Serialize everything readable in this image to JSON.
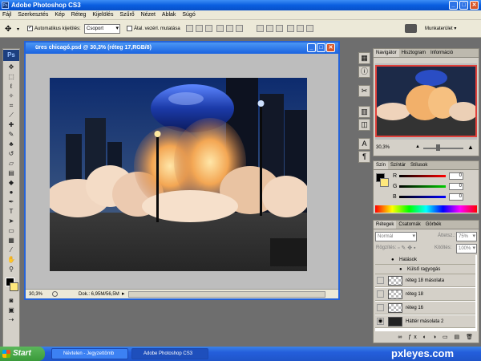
{
  "app": {
    "title": "Adobe Photoshop CS3",
    "ps_badge": "Ps"
  },
  "menu": [
    "Fájl",
    "Szerkesztés",
    "Kép",
    "Réteg",
    "Kijelölés",
    "Szűrő",
    "Nézet",
    "Ablak",
    "Súgó"
  ],
  "options": {
    "auto_select_label": "Automatikus kijelölés:",
    "auto_select_checked": true,
    "group_value": "Csoport",
    "transform_label": "Átal. vezérl. mutatása",
    "transform_checked": false,
    "workspace_label": "Munkaterület"
  },
  "document": {
    "title": "üres chicagó.psd @ 30,3% (réteg 17,RGB/8)",
    "zoom": "30,3%",
    "doc_info": "Dok.: 6,95M/56,5M"
  },
  "navigator": {
    "tabs": [
      "Navigátor",
      "Hisztogram",
      "Információ"
    ],
    "zoom": "30,3%"
  },
  "color_panel": {
    "tabs": [
      "Szín",
      "Színtár",
      "Stílusok"
    ],
    "channels": [
      {
        "label": "R",
        "value": "0"
      },
      {
        "label": "G",
        "value": "0"
      },
      {
        "label": "B",
        "value": "0"
      }
    ]
  },
  "layers_panel": {
    "tabs": [
      "Rétegek",
      "Csatornák",
      "Görbék"
    ],
    "blend_mode": "Normál",
    "opacity_label": "Áttetsz.:",
    "opacity": "75%",
    "lock_label": "Rögzítés:",
    "fill_label": "Kitöltés:",
    "fill": "100%",
    "layers": [
      {
        "name": "Hatások",
        "type": "effects"
      },
      {
        "name": "Külső ragyogás",
        "type": "effect"
      },
      {
        "name": "réteg 18 másolata",
        "type": "layer"
      },
      {
        "name": "réteg 18",
        "type": "layer"
      },
      {
        "name": "réteg 16",
        "type": "layer"
      },
      {
        "name": "Háttér másolata 2",
        "type": "layer"
      }
    ]
  },
  "taskbar": {
    "start": "Start",
    "tasks": [
      "Névtelen - Jegyzettömb",
      "Adobe Photoshop CS3"
    ]
  },
  "watermark": "pxleyes.com",
  "colors": {
    "xp_blue": "#245edb",
    "ps_panel": "#d4d0c8",
    "selected_layer": "#316ac5"
  }
}
